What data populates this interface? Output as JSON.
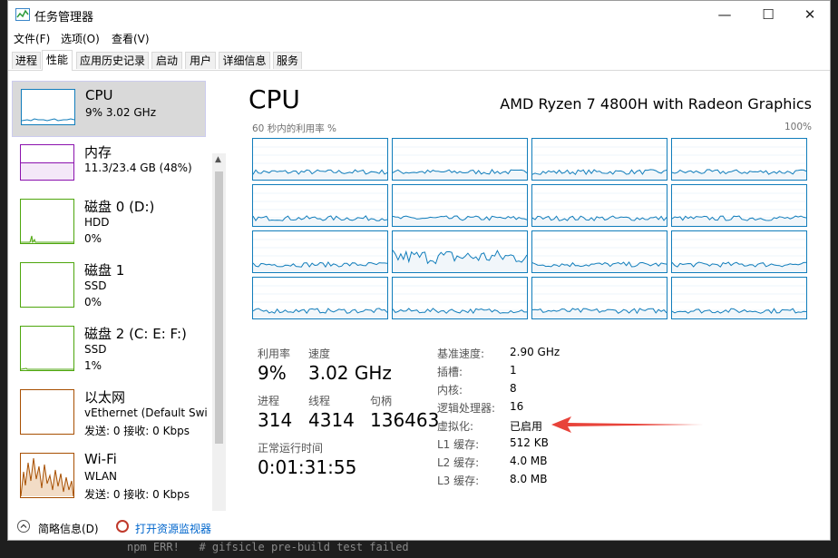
{
  "window": {
    "title": "任务管理器"
  },
  "menubar": [
    "文件(F)",
    "选项(O)",
    "查看(V)"
  ],
  "tabs": [
    {
      "label": "进程",
      "active": false
    },
    {
      "label": "性能",
      "active": true
    },
    {
      "label": "应用历史记录",
      "active": false
    },
    {
      "label": "启动",
      "active": false
    },
    {
      "label": "用户",
      "active": false
    },
    {
      "label": "详细信息",
      "active": false
    },
    {
      "label": "服务",
      "active": false
    }
  ],
  "sidebar": {
    "items": [
      {
        "name": "CPU",
        "line2": "9% 3.02 GHz",
        "line3": "",
        "color": "#117dbb",
        "selected": true
      },
      {
        "name": "内存",
        "line2": "11.3/23.4 GB (48%)",
        "line3": "",
        "color": "#8b12ae",
        "selected": false
      },
      {
        "name": "磁盘 0 (D:)",
        "line2": "HDD",
        "line3": "0%",
        "color": "#4da60c",
        "selected": false
      },
      {
        "name": "磁盘 1",
        "line2": "SSD",
        "line3": "0%",
        "color": "#4da60c",
        "selected": false
      },
      {
        "name": "磁盘 2 (C: E: F:)",
        "line2": "SSD",
        "line3": "1%",
        "color": "#4da60c",
        "selected": false
      },
      {
        "name": "以太网",
        "line2": "vEthernet (Default Swi...",
        "line3": "发送: 0 接收: 0 Kbps",
        "color": "#a74f01",
        "selected": false
      },
      {
        "name": "Wi-Fi",
        "line2": "WLAN",
        "line3": "发送: 0 接收: 0 Kbps",
        "color": "#a74f01",
        "selected": false
      }
    ]
  },
  "main": {
    "title": "CPU",
    "model": "AMD Ryzen 7 4800H with Radeon Graphics",
    "graph_label": "60 秒内的利用率 %",
    "graph_max": "100%",
    "stats": {
      "util_label": "利用率",
      "util": "9%",
      "speed_label": "速度",
      "speed": "3.02 GHz",
      "proc_label": "进程",
      "proc": "314",
      "threads_label": "线程",
      "threads": "4314",
      "handles_label": "句柄",
      "handles": "136463",
      "uptime_label": "正常运行时间",
      "uptime": "0:01:31:55"
    },
    "right": [
      {
        "k": "基准速度:",
        "v": "2.90 GHz"
      },
      {
        "k": "插槽:",
        "v": "1"
      },
      {
        "k": "内核:",
        "v": "8"
      },
      {
        "k": "逻辑处理器:",
        "v": "16"
      },
      {
        "k": "虚拟化:",
        "v": "已启用"
      },
      {
        "k": "L1 缓存:",
        "v": "512 KB"
      },
      {
        "k": "L2 缓存:",
        "v": "4.0 MB"
      },
      {
        "k": "L3 缓存:",
        "v": "8.0 MB"
      }
    ]
  },
  "footer": {
    "summary": "简略信息(D)",
    "monitor": "打开资源监视器"
  },
  "colors": {
    "cpu": "#117dbb",
    "annotation": "#e8433a"
  },
  "background": {
    "terminal_text": "npm ERR!   # gifsicle pre-build test failed"
  }
}
